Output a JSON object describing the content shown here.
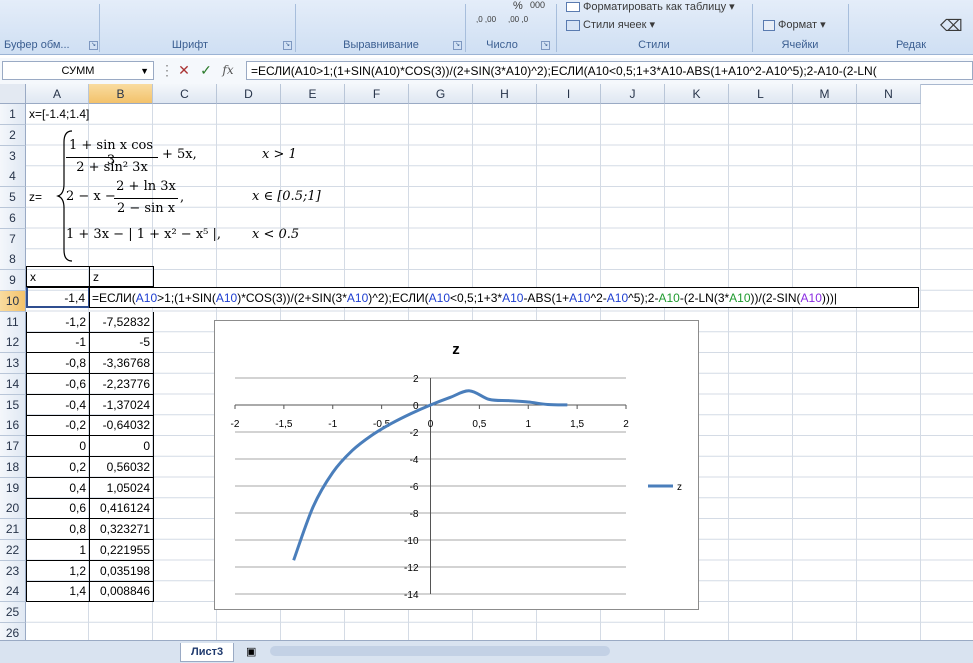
{
  "ribbon": {
    "groups": [
      {
        "label": "Буфер обм...",
        "launcher": true
      },
      {
        "label": "Шрифт",
        "launcher": true
      },
      {
        "label": "Выравнивание",
        "launcher": true
      },
      {
        "label": "Число",
        "launcher": true
      },
      {
        "label": "Стили",
        "launcher": false
      },
      {
        "label": "Ячейки",
        "launcher": false
      },
      {
        "label": "Редак",
        "launcher": false
      }
    ],
    "format_as_table": "Форматировать как таблицу",
    "cell_styles": "Стили ячеек",
    "format": "Формат",
    "percent_symbol": "%",
    "thousands_symbol": "000",
    "decimal_increase": ",0 ,00",
    "decimal_decrease": ",00 ,0"
  },
  "formula_bar": {
    "name_box": "СУММ",
    "fx": "fx",
    "formula": "=ЕСЛИ(A10>1;(1+SIN(A10)*COS(3))/(2+SIN(3*A10)^2);ЕСЛИ(A10<0,5;1+3*A10-ABS(1+A10^2-A10^5);2-A10-(2-LN("
  },
  "columns": [
    "A",
    "B",
    "C",
    "D",
    "E",
    "F",
    "G",
    "H",
    "I",
    "J",
    "K",
    "L",
    "M",
    "N"
  ],
  "selected_column": "B",
  "rows": [
    "1",
    "2",
    "3",
    "4",
    "5",
    "6",
    "7",
    "8",
    "9",
    "10",
    "11",
    "12",
    "13",
    "14",
    "15",
    "16",
    "17",
    "18",
    "19",
    "20",
    "21",
    "22",
    "23",
    "24",
    "25",
    "26"
  ],
  "selected_row": "10",
  "sheet": {
    "a1": "x=[-1.4;1.4]",
    "a5": "z=",
    "header_x": "x",
    "header_z": "z",
    "edit_cell_a10": "-1,4",
    "edit_formula": [
      {
        "t": "=ЕСЛИ(",
        "c": ""
      },
      {
        "t": "A10",
        "c": "ref1"
      },
      {
        "t": ">1;(1+SIN(",
        "c": ""
      },
      {
        "t": "A10",
        "c": "ref1"
      },
      {
        "t": ")*COS(3))/(2+SIN(3*",
        "c": ""
      },
      {
        "t": "A10",
        "c": "ref1"
      },
      {
        "t": ")^2);ЕСЛИ(",
        "c": ""
      },
      {
        "t": "A10",
        "c": "ref1"
      },
      {
        "t": "<0,5;1+3*",
        "c": ""
      },
      {
        "t": "A10",
        "c": "ref1"
      },
      {
        "t": "-ABS(1+",
        "c": ""
      },
      {
        "t": "A10",
        "c": "ref1"
      },
      {
        "t": "^2-",
        "c": ""
      },
      {
        "t": "A10",
        "c": "ref1"
      },
      {
        "t": "^5);2-",
        "c": ""
      },
      {
        "t": "A10",
        "c": "ref2"
      },
      {
        "t": "-(2-LN(3*",
        "c": ""
      },
      {
        "t": "A10",
        "c": "ref2"
      },
      {
        "t": "))/(2-SIN(",
        "c": ""
      },
      {
        "t": "A10",
        "c": "ref3"
      },
      {
        "t": ")))",
        "c": ""
      }
    ],
    "data_rows": [
      {
        "x": "-1,2",
        "z": "-7,52832"
      },
      {
        "x": "-1",
        "z": "-5"
      },
      {
        "x": "-0,8",
        "z": "-3,36768"
      },
      {
        "x": "-0,6",
        "z": "-2,23776"
      },
      {
        "x": "-0,4",
        "z": "-1,37024"
      },
      {
        "x": "-0,2",
        "z": "-0,64032"
      },
      {
        "x": "0",
        "z": "0"
      },
      {
        "x": "0,2",
        "z": "0,56032"
      },
      {
        "x": "0,4",
        "z": "1,05024"
      },
      {
        "x": "0,6",
        "z": "0,416124"
      },
      {
        "x": "0,8",
        "z": "0,323271"
      },
      {
        "x": "1",
        "z": "0,221955"
      },
      {
        "x": "1,2",
        "z": "0,035198"
      },
      {
        "x": "1,4",
        "z": "0,008846"
      }
    ]
  },
  "equation": {
    "case1_num": "1 + sin x cos 3",
    "case1_den": "2 + sin² 3x",
    "case1_tail": "+ 5x,",
    "case1_cond": "x > 1",
    "case2_head": "2 − x −",
    "case2_num": "2 + ln 3x",
    "case2_den": "2 − sin x",
    "case2_tail": ",",
    "case2_cond": "x ∈ [0.5;1]",
    "case3_expr": "1 + 3x − | 1 + x² − x⁵ |,",
    "case3_cond": "x < 0.5"
  },
  "chart_data": {
    "type": "line",
    "title": "z",
    "x": [
      -1.4,
      -1.2,
      -1,
      -0.8,
      -0.6,
      -0.4,
      -0.2,
      0,
      0.2,
      0.4,
      0.6,
      0.8,
      1,
      1.2,
      1.4
    ],
    "series": [
      {
        "name": "z",
        "values": [
          -11.5,
          -7.52832,
          -5,
          -3.36768,
          -2.23776,
          -1.37024,
          -0.64032,
          0,
          0.56032,
          1.05024,
          0.416124,
          0.323271,
          0.221955,
          0.035198,
          0.008846
        ]
      }
    ],
    "xlim": [
      -2,
      2
    ],
    "ylim": [
      -14,
      2
    ],
    "x_ticks": [
      "-2",
      "-1,5",
      "-1",
      "-0,5",
      "0",
      "0,5",
      "1",
      "1,5",
      "2"
    ],
    "y_ticks": [
      "2",
      "0",
      "-2",
      "-4",
      "-6",
      "-8",
      "-10",
      "-12",
      "-14"
    ],
    "grid": true,
    "legend": "right",
    "line_color": "#4a7ebb"
  },
  "tabs": {
    "active": "Лист3"
  }
}
